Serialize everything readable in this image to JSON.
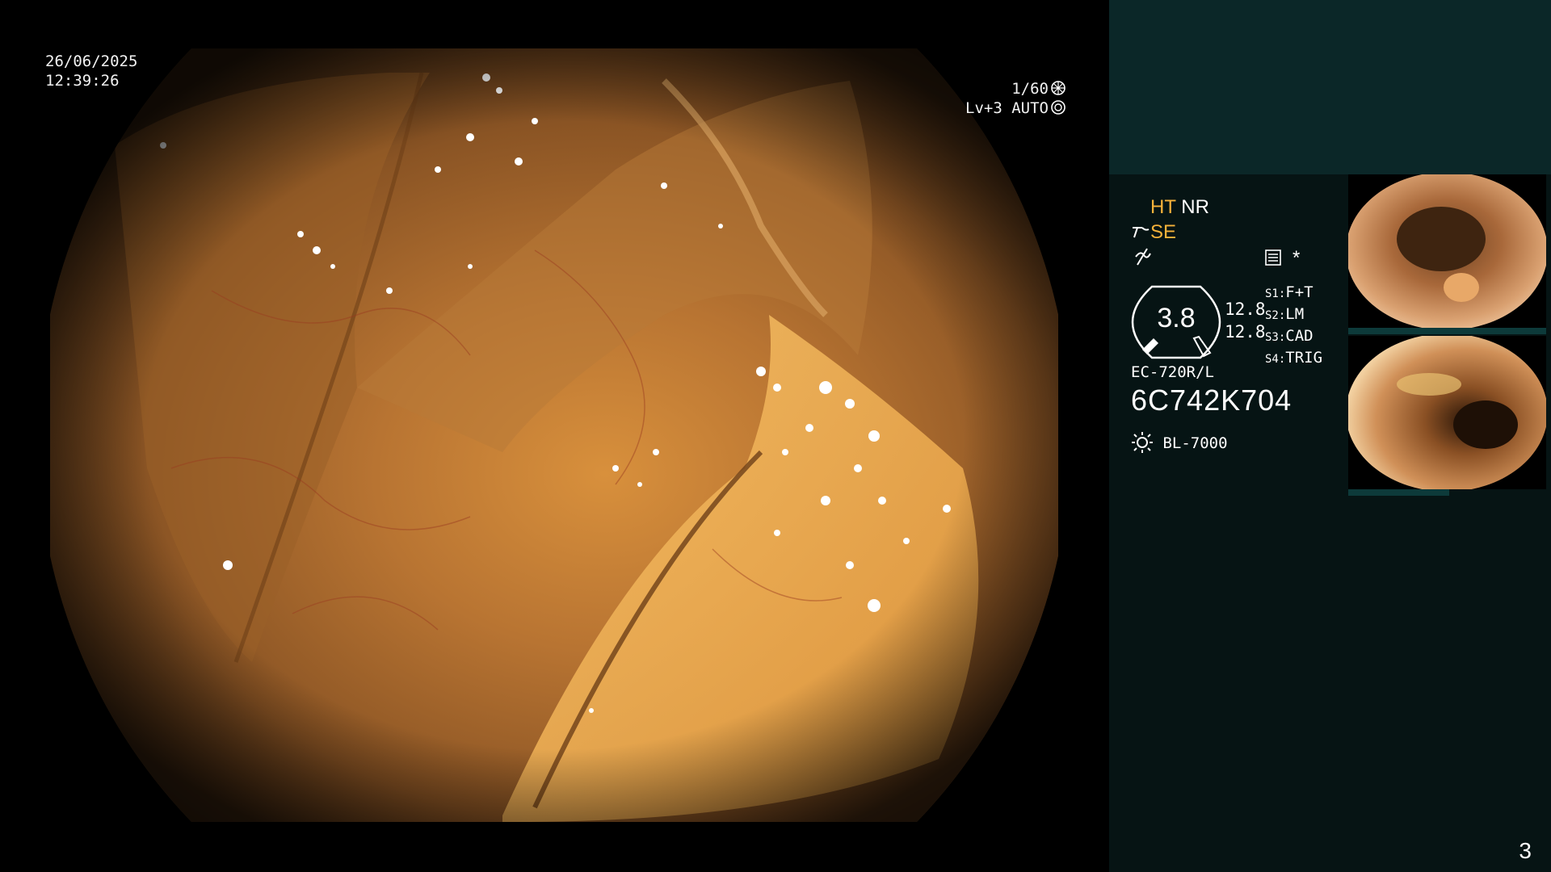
{
  "overlay": {
    "date": "26/06/2025",
    "time": "12:39:26",
    "shutter": "1/60",
    "shutter_icon": "shutter-icon",
    "iris": "Lv+3 AUTO",
    "iris_icon": "iris-icon"
  },
  "panel": {
    "mode_ht": "HT",
    "mode_nr": "NR",
    "mode_se": "SE",
    "se_icon": "enhance-icon",
    "sharp_icon": "sharpness-icon",
    "menu_icon": "memory-icon",
    "asterisk": "*",
    "gauge_value": "3.8",
    "gauge_upper": "12.8",
    "gauge_lower": "12.8",
    "switches": [
      {
        "key": "S1:",
        "value": "F+T"
      },
      {
        "key": "S2:",
        "value": "LM"
      },
      {
        "key": "S3:",
        "value": "CAD"
      },
      {
        "key": "S4:",
        "value": "TRIG"
      }
    ],
    "scope_model": "EC-720R/L",
    "scope_serial": "6C742K704",
    "light_icon": "light-source-icon",
    "light_source": "BL-7000"
  },
  "thumbnails": [
    {
      "name": "captured-image-1"
    },
    {
      "name": "captured-image-2"
    }
  ],
  "page_number": "3",
  "colors": {
    "panel_bg": "#061414",
    "panel_top": "#0b2728",
    "accent_orange": "#f7b23a"
  }
}
